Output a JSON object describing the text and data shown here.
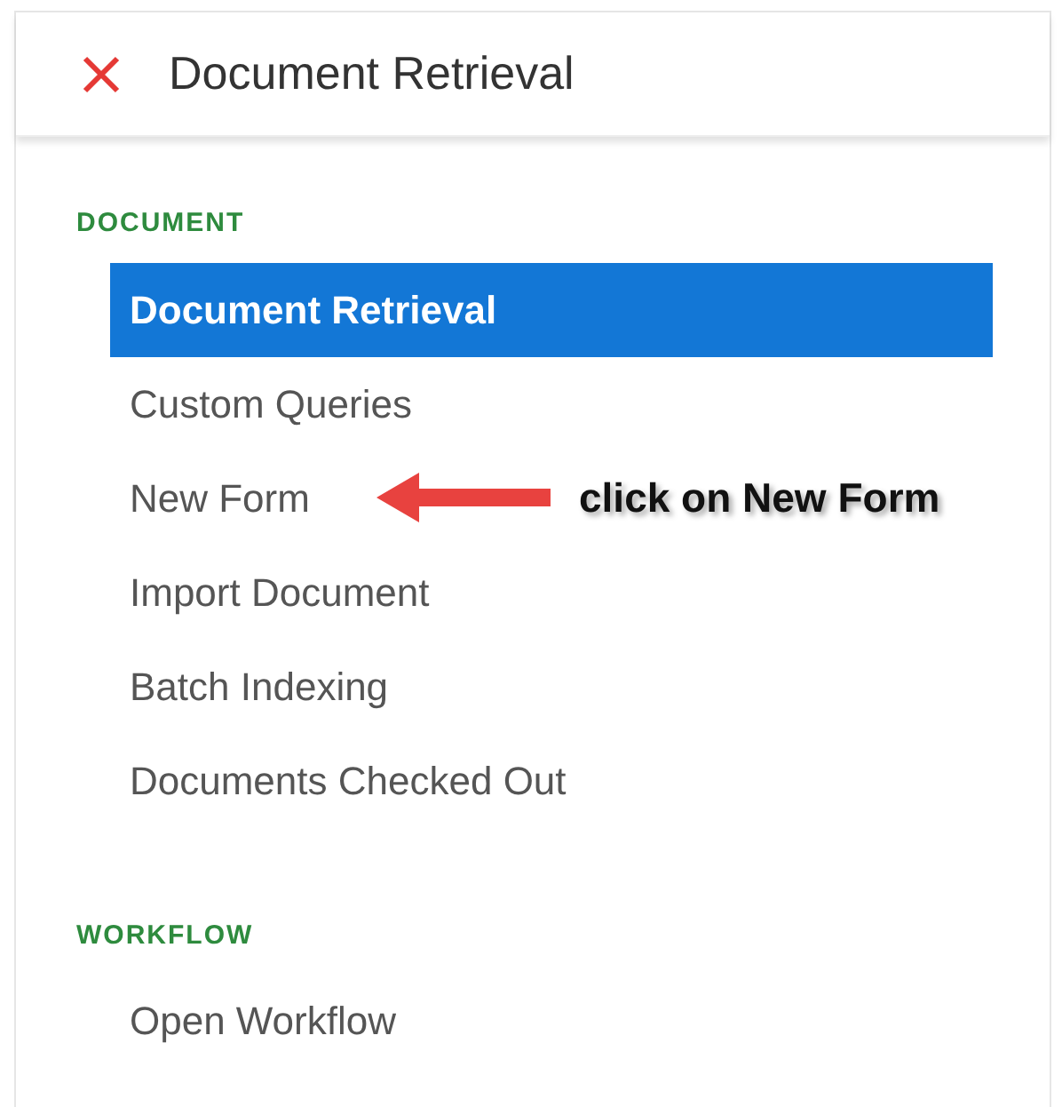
{
  "header": {
    "title": "Document Retrieval"
  },
  "sections": [
    {
      "heading": "DOCUMENT",
      "items": [
        {
          "label": "Document Retrieval",
          "selected": true
        },
        {
          "label": "Custom Queries",
          "selected": false
        },
        {
          "label": "New Form",
          "selected": false,
          "annotation": "click on New Form"
        },
        {
          "label": "Import Document",
          "selected": false
        },
        {
          "label": "Batch Indexing",
          "selected": false
        },
        {
          "label": "Documents Checked Out",
          "selected": false
        }
      ]
    },
    {
      "heading": "WORKFLOW",
      "items": [
        {
          "label": "Open Workflow",
          "selected": false
        }
      ]
    }
  ]
}
